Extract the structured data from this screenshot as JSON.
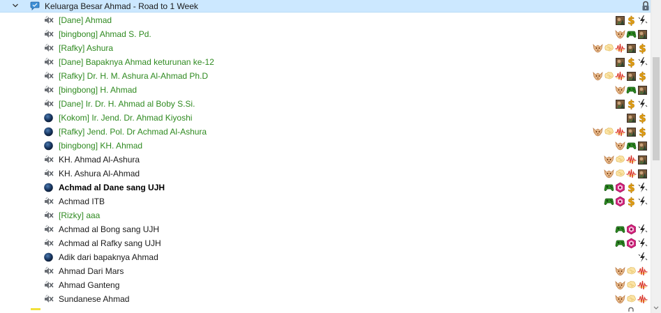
{
  "channel": {
    "name": "Keluarga Besar Ahmad - Road to 1 Week"
  },
  "colors": {
    "selected_bg": "#cce8ff",
    "group_name": "#2f8a20",
    "text": "#1a1a1a"
  },
  "icons": {
    "status_muted": "speaker-muted-icon",
    "status_away": "dark-ball-icon"
  },
  "clients": [
    {
      "name": "[Dane] Ahmad",
      "status": "muted",
      "green": true,
      "bold": false,
      "badges": [
        "art",
        "dollar",
        "bolt"
      ]
    },
    {
      "name": "[bingbong] Ahmad S. Pd.",
      "status": "muted",
      "green": true,
      "bold": false,
      "badges": [
        "wolf",
        "gamepad",
        "art"
      ]
    },
    {
      "name": "[Rafky] Ashura",
      "status": "muted",
      "green": true,
      "bold": false,
      "badges": [
        "wolf",
        "brain",
        "pulse",
        "art",
        "dollar"
      ]
    },
    {
      "name": "[Dane] Bapaknya Ahmad keturunan ke-12",
      "status": "muted",
      "green": true,
      "bold": false,
      "badges": [
        "art",
        "dollar",
        "bolt"
      ]
    },
    {
      "name": "[Rafky] Dr. H. M. Ashura Al-Ahmad Ph.D",
      "status": "muted",
      "green": true,
      "bold": false,
      "badges": [
        "wolf",
        "brain",
        "pulse",
        "art",
        "dollar"
      ]
    },
    {
      "name": "[bingbong] H. Ahmad",
      "status": "muted",
      "green": true,
      "bold": false,
      "badges": [
        "wolf",
        "gamepad",
        "art"
      ]
    },
    {
      "name": "[Dane] Ir. Dr. H. Ahmad al Boby S.Si.",
      "status": "muted",
      "green": true,
      "bold": false,
      "badges": [
        "art",
        "dollar",
        "bolt"
      ]
    },
    {
      "name": "[Kokom] Ir. Jend. Dr. Ahmad Kiyoshi",
      "status": "away",
      "green": true,
      "bold": false,
      "badges": [
        "art",
        "dollar"
      ]
    },
    {
      "name": "[Rafky] Jend. Pol. Dr Achmad Al-Ashura",
      "status": "away",
      "green": true,
      "bold": false,
      "badges": [
        "wolf",
        "brain",
        "pulse",
        "art",
        "dollar"
      ]
    },
    {
      "name": "[bingbong] KH. Ahmad",
      "status": "away",
      "green": true,
      "bold": false,
      "badges": [
        "wolf",
        "gamepad",
        "art"
      ]
    },
    {
      "name": "KH. Ahmad Al-Ashura",
      "status": "muted",
      "green": false,
      "bold": false,
      "badges": [
        "wolf",
        "brain",
        "pulse",
        "art"
      ]
    },
    {
      "name": "KH. Ashura Al-Ahmad",
      "status": "muted",
      "green": false,
      "bold": false,
      "badges": [
        "wolf",
        "brain",
        "pulse",
        "art"
      ]
    },
    {
      "name": "Achmad al Dane sang UJH",
      "status": "away",
      "green": false,
      "bold": true,
      "badges": [
        "gamepad",
        "dragon",
        "dollar",
        "bolt"
      ]
    },
    {
      "name": "Achmad ITB",
      "status": "muted",
      "green": false,
      "bold": false,
      "badges": [
        "gamepad",
        "dragon",
        "dollar",
        "bolt"
      ]
    },
    {
      "name": "[Rizky] aaa",
      "status": "muted",
      "green": true,
      "bold": false,
      "badges": []
    },
    {
      "name": "Achmad al Bong sang UJH",
      "status": "muted",
      "green": false,
      "bold": false,
      "badges": [
        "gamepad",
        "dragon",
        "bolt"
      ]
    },
    {
      "name": "Achmad al Rafky sang UJH",
      "status": "muted",
      "green": false,
      "bold": false,
      "badges": [
        "gamepad",
        "dragon",
        "bolt"
      ]
    },
    {
      "name": "Adik dari bapaknya Ahmad",
      "status": "away",
      "green": false,
      "bold": false,
      "badges": [
        "bolt"
      ]
    },
    {
      "name": "Ahmad Dari Mars",
      "status": "muted",
      "green": false,
      "bold": false,
      "badges": [
        "wolf",
        "brain",
        "pulse"
      ]
    },
    {
      "name": "Ahmad Ganteng",
      "status": "muted",
      "green": false,
      "bold": false,
      "badges": [
        "wolf",
        "brain",
        "pulse"
      ]
    },
    {
      "name": "Sundanese Ahmad",
      "status": "muted",
      "green": false,
      "bold": false,
      "badges": [
        "wolf",
        "brain",
        "pulse"
      ]
    }
  ]
}
